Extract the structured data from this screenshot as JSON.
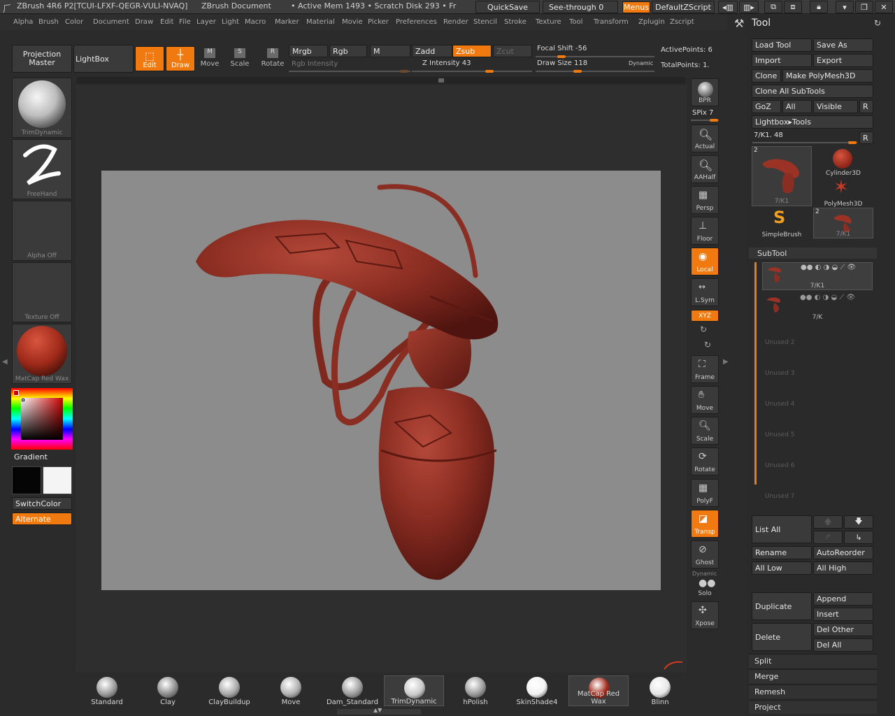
{
  "titlebar": {
    "app": "ZBrush 4R6 P2[TCUI-LFXF-QEGR-VULI-NVAQ]",
    "document": "ZBrush Document",
    "mem": "• Active Mem 1493 • Scratch Disk 293 • Fr",
    "quicksave": "QuickSave",
    "seethrough": "See-through  0",
    "menus": "Menus",
    "script": "DefaultZScript"
  },
  "menus": [
    "Alpha",
    "Brush",
    "Color",
    "Document",
    "Draw",
    "Edit",
    "File",
    "Layer",
    "Light",
    "Macro",
    "Marker",
    "Material",
    "Movie",
    "Picker",
    "Preferences",
    "Render",
    "Stencil",
    "Stroke",
    "Texture",
    "Tool",
    "Transform",
    "Zplugin",
    "Zscript"
  ],
  "toolbar": {
    "projection_master": "Projection Master",
    "lightbox": "LightBox",
    "edit": "Edit",
    "draw": "Draw",
    "move": "Move",
    "scale": "Scale",
    "rotate": "Rotate",
    "mrgb": "Mrgb",
    "rgb": "Rgb",
    "m": "M",
    "zadd": "Zadd",
    "zsub": "Zsub",
    "zcut": "Zcut",
    "rgb_intensity": "Rgb Intensity",
    "z_intensity": "Z Intensity 43",
    "z_intensity_value": 43,
    "focal_shift": "Focal Shift -56",
    "focal_shift_value": -56,
    "draw_size": "Draw Size 118",
    "draw_size_value": 118,
    "dynamic": "Dynamic",
    "active_points": "ActivePoints: 6",
    "total_points": "TotalPoints: 1."
  },
  "left_shelf": {
    "brush": "TrimDynamic",
    "stroke": "FreeHand",
    "alpha": "Alpha Off",
    "texture": "Texture Off",
    "material": "MatCap Red Wax",
    "gradient": "Gradient",
    "switchcolor": "SwitchColor",
    "alternate": "Alternate"
  },
  "right_shelf": {
    "bpr": "BPR",
    "spix": "SPix 7",
    "actual": "Actual",
    "aahalf": "AAHalf",
    "persp": "Persp",
    "floor": "Floor",
    "local": "Local",
    "lsym": "L.Sym",
    "xyz": "XYZ",
    "frame": "Frame",
    "move": "Move",
    "scale": "Scale",
    "rotate": "Rotate",
    "polyf": "PolyF",
    "transp": "Transp",
    "ghost": "Ghost",
    "dynamic": "Dynamic",
    "solo": "Solo",
    "xpose": "Xpose"
  },
  "tool_panel": {
    "title": "Tool",
    "load_tool": "Load Tool",
    "save_as": "Save As",
    "import": "Import",
    "export": "Export",
    "clone": "Clone",
    "make_polymesh": "Make PolyMesh3D",
    "clone_all": "Clone All SubTools",
    "goz": "GoZ",
    "all": "All",
    "visible": "Visible",
    "r": "R",
    "lightbox_tools": "Lightbox▸Tools",
    "current_tool": "7/K1. 48",
    "tools": [
      {
        "name": "7/K1",
        "count": "2"
      },
      {
        "name": "Cylinder3D"
      },
      {
        "name": "PolyMesh3D"
      },
      {
        "name": "SimpleBrush"
      },
      {
        "name": "7/K1",
        "count": "2"
      }
    ],
    "subtool_title": "SubTool",
    "subtools": [
      "7/K1",
      "7/K"
    ],
    "unused": [
      "Unused 2",
      "Unused 3",
      "Unused 4",
      "Unused 5",
      "Unused 6",
      "Unused 7"
    ],
    "list_all": "List All",
    "rename": "Rename",
    "autoreorder": "AutoReorder",
    "all_low": "All Low",
    "all_high": "All High",
    "duplicate": "Duplicate",
    "append": "Append",
    "insert": "Insert",
    "delete": "Delete",
    "del_other": "Del Other",
    "del_all": "Del All",
    "split": "Split",
    "merge": "Merge",
    "remesh": "Remesh",
    "project": "Project"
  },
  "brush_tray": [
    {
      "name": "Standard",
      "color": "#9a9a9a"
    },
    {
      "name": "Clay",
      "color": "#8c8c8c"
    },
    {
      "name": "ClayBuildup",
      "color": "#a8a8a8"
    },
    {
      "name": "Move",
      "color": "#b0b0b0"
    },
    {
      "name": "Dam_Standard",
      "color": "#9c9c9c"
    },
    {
      "name": "TrimDynamic",
      "color": "#c8c8c8"
    },
    {
      "name": "hPolish",
      "color": "#9a9a9a"
    },
    {
      "name": "SkinShade4",
      "color": "#f2f2f2"
    },
    {
      "name": "MatCap Red Wax",
      "color": "#a12a1a"
    },
    {
      "name": "Blinn",
      "color": "#e6e6e6"
    }
  ],
  "colors": {
    "accent": "#f07a10",
    "canvas": "#8c8c8c",
    "model": "#8a2d22"
  }
}
